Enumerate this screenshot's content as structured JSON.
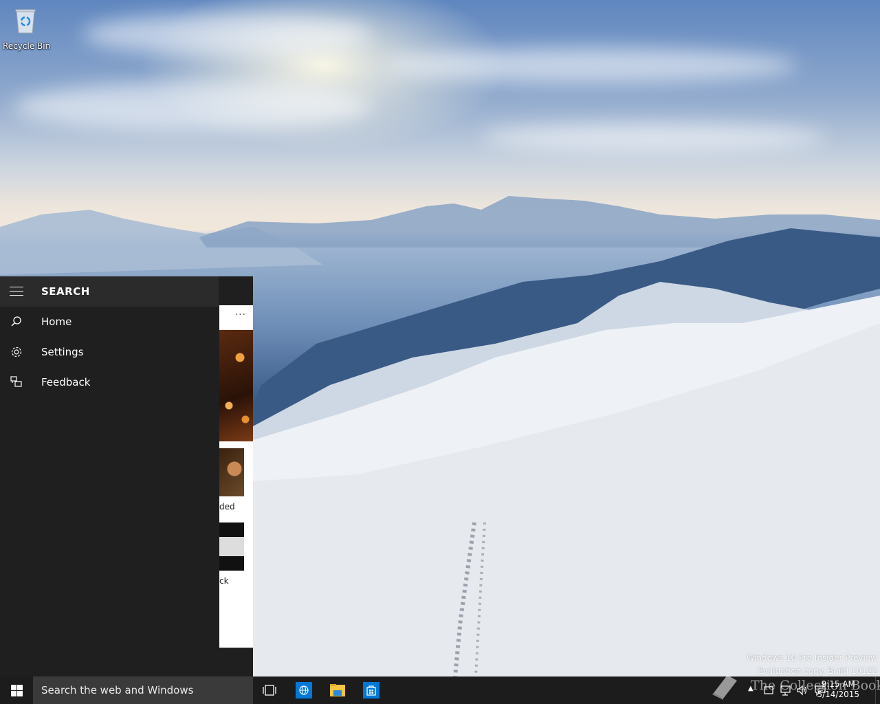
{
  "desktop": {
    "icons": [
      {
        "label": "Recycle Bin"
      }
    ],
    "watermark": {
      "line1": "Windows 10 Pro Insider Preview",
      "line2": "Evaluation copy. Build 10122",
      "brand": "The Collection Book"
    }
  },
  "search_menu": {
    "title": "SEARCH",
    "items": [
      {
        "label": "Home",
        "icon": "search-icon"
      },
      {
        "label": "Settings",
        "icon": "gear-icon"
      },
      {
        "label": "Feedback",
        "icon": "feedback-icon"
      }
    ]
  },
  "content_pane": {
    "more_label": "···",
    "snippet1": "ded",
    "snippet2": "ck"
  },
  "taskbar": {
    "search_placeholder": "Search the web and Windows",
    "pinned": [
      {
        "name": "task-view",
        "icon": "task-view-icon"
      },
      {
        "name": "internet-explorer",
        "icon": "globe-icon"
      },
      {
        "name": "file-explorer",
        "icon": "folder-icon"
      },
      {
        "name": "store",
        "icon": "store-icon"
      }
    ],
    "clock": {
      "time": "9:15 AM",
      "date": "5/14/2015"
    }
  },
  "colors": {
    "accent": "#0078d7",
    "menu_bg": "#1f1f1f",
    "menu_header_bg": "#2b2b2b",
    "taskbar_bg": "#1c1c1c",
    "search_box_bg": "#3a3a3a"
  }
}
